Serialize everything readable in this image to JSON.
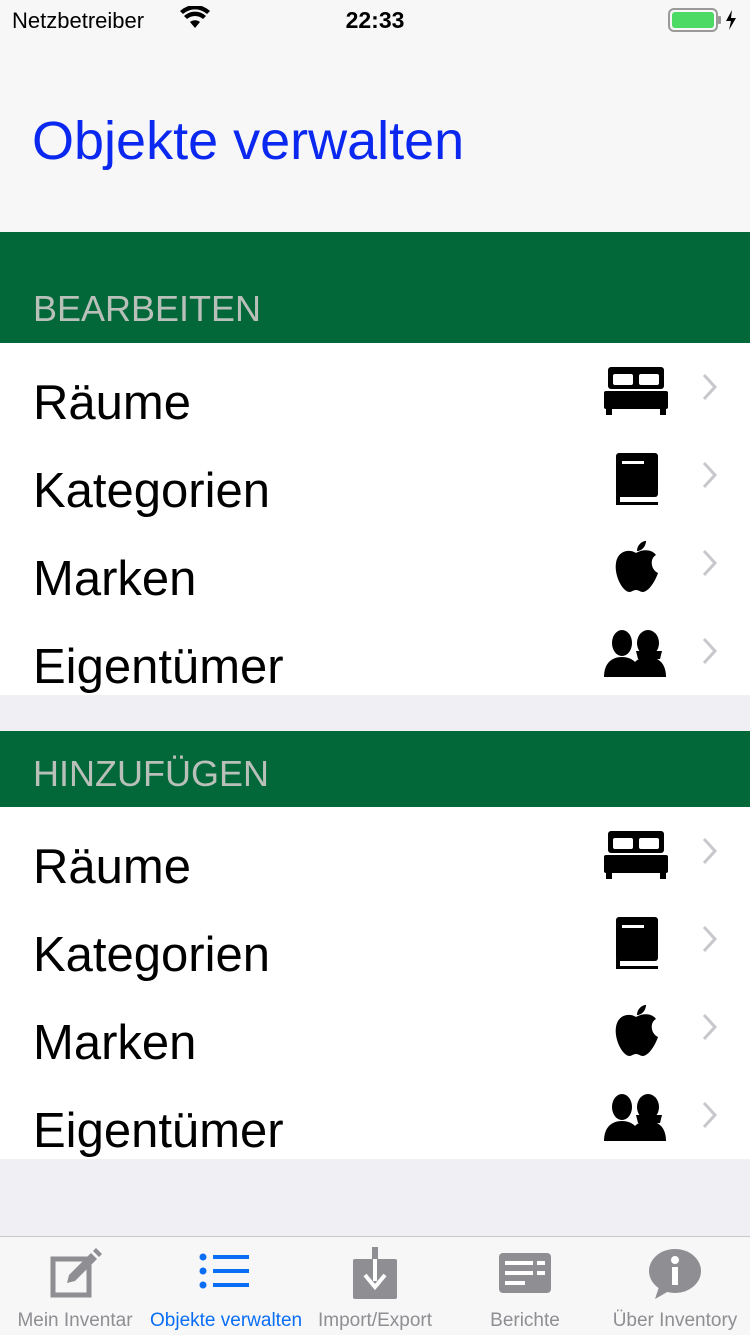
{
  "status_bar": {
    "carrier": "Netzbetreiber",
    "time": "22:33"
  },
  "header": {
    "title": "Objekte verwalten"
  },
  "sections": [
    {
      "header": "BEARBEITEN",
      "items": [
        {
          "label": "Räume",
          "icon": "bed-icon"
        },
        {
          "label": "Kategorien",
          "icon": "book-icon"
        },
        {
          "label": "Marken",
          "icon": "apple-icon"
        },
        {
          "label": "Eigentümer",
          "icon": "people-icon"
        }
      ]
    },
    {
      "header": "HINZUFÜGEN",
      "items": [
        {
          "label": "Räume",
          "icon": "bed-icon"
        },
        {
          "label": "Kategorien",
          "icon": "book-icon"
        },
        {
          "label": "Marken",
          "icon": "apple-icon"
        },
        {
          "label": "Eigentümer",
          "icon": "people-icon"
        }
      ]
    }
  ],
  "tab_bar": {
    "tabs": [
      {
        "label": "Mein Inventar",
        "icon": "edit-icon"
      },
      {
        "label": "Objekte verwalten",
        "icon": "list-icon",
        "active": true
      },
      {
        "label": "Import/Export",
        "icon": "download-icon"
      },
      {
        "label": "Berichte",
        "icon": "report-icon"
      },
      {
        "label": "Über Inventory",
        "icon": "info-icon"
      }
    ]
  },
  "colors": {
    "title": "#0a28f0",
    "section_header_bg": "#02683a",
    "section_header_text": "#b9c0b9",
    "tab_active": "#0a6ef5",
    "tab_inactive": "#8e8e93",
    "battery": "#4cd964"
  }
}
